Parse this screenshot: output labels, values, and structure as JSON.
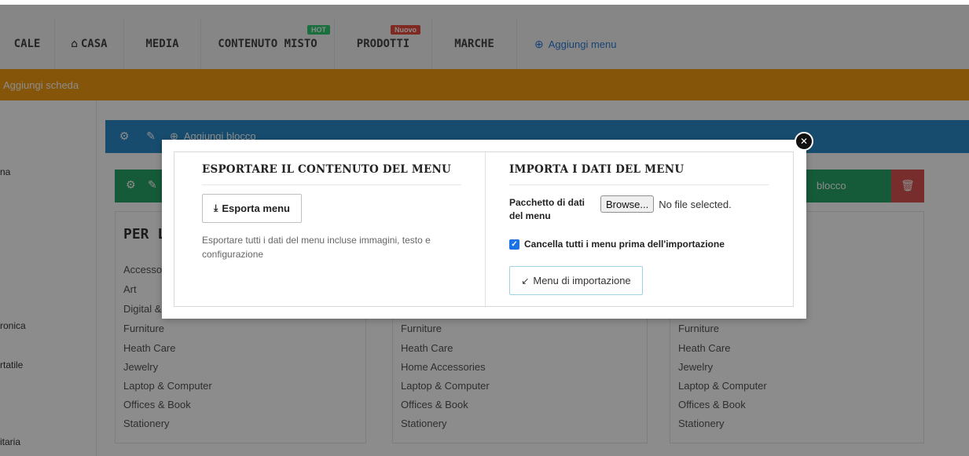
{
  "topnav": {
    "tabs": [
      {
        "label": "CALE",
        "icon": ""
      },
      {
        "label": "CASA",
        "icon": "home-icon"
      },
      {
        "label": "MEDIA",
        "icon": ""
      },
      {
        "label": "CONTENUTO MISTO",
        "icon": "",
        "badge": "HOT"
      },
      {
        "label": "PRODOTTI",
        "icon": "",
        "badge": "Nuovo"
      },
      {
        "label": "MARCHE",
        "icon": ""
      }
    ],
    "add_menu_label": "Aggiungi menu"
  },
  "tab_row": {
    "add_tab_label": "Aggiungi scheda"
  },
  "sidebar": {
    "items": [
      "na",
      "ronica",
      "rtatile",
      "itaria"
    ]
  },
  "column_header": {
    "add_block_label": "Aggiungi blocco"
  },
  "block_bar": {
    "right_label": "blocco"
  },
  "columns": [
    {
      "title": "PER LA",
      "items": [
        "Accesso",
        "Art",
        "Digital &",
        "Furniture",
        "Heath Care",
        "Jewelry",
        "Laptop & Computer",
        "Offices & Book",
        "Stationery"
      ]
    },
    {
      "title": "",
      "items": [
        "",
        "",
        "",
        "Furniture",
        "Heath Care",
        "Home Accessories",
        "Laptop & Computer",
        "Offices & Book",
        "Stationery"
      ]
    },
    {
      "title": "",
      "items": [
        "",
        "",
        "",
        "Furniture",
        "Heath Care",
        "Jewelry",
        "Laptop & Computer",
        "Offices & Book",
        "Stationery"
      ]
    }
  ],
  "modal": {
    "export": {
      "title": "ESPORTARE IL CONTENUTO DEL MENU",
      "button_label": "Esporta menu",
      "button_icon": "download-icon",
      "description": "Esportare tutti i dati del menu incluse immagini, testo e configurazione"
    },
    "import": {
      "title": "IMPORTA I DATI DEL MENU",
      "package_label": "Pacchetto di dati del menu",
      "browse_label": "Browse...",
      "file_status": "No file selected.",
      "checkbox_label": "Cancella tutti i menu prima dell'importazione",
      "checkbox_checked": true,
      "button_label": "Menu di importazione",
      "button_icon": "compress-icon"
    },
    "close_icon": "close-icon"
  },
  "colors": {
    "top_bar": "#f5f5f5",
    "orange_row": "#f39c12",
    "blue_header": "#2a8bc9",
    "green_bar": "#27a468",
    "trash_red": "#d9534f",
    "badge_hot": "#2ecc71",
    "badge_new": "#e74c3c",
    "checkbox": "#1a73e8"
  }
}
